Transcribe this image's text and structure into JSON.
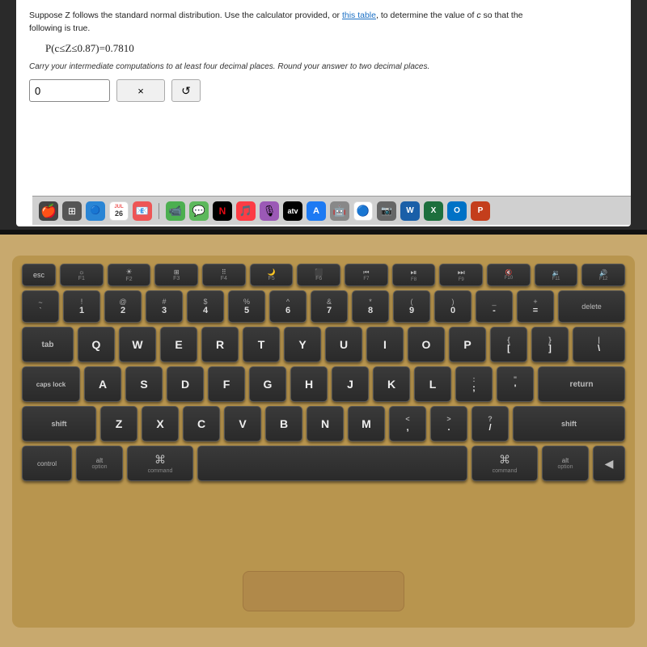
{
  "screen": {
    "problem_line1": "Suppose Z follows the standard normal distribution. Use the calculator provided, or ",
    "problem_link": "this table",
    "problem_line2": ", to determine the value of ",
    "problem_italic": "c",
    "problem_line3": " so that the",
    "problem_line4": "following is true.",
    "formula": "P(c≤Z≤0.87)=0.7810",
    "carry_text": "Carry your intermediate computations to at least four decimal places. Round your answer to two decimal places.",
    "input_placeholder": "0",
    "btn_x_label": "×",
    "btn_reset_label": "↺"
  },
  "dock": {
    "icons": [
      "🍎",
      "⊞",
      "📅",
      "🟢",
      "✉",
      "💬",
      "🎵",
      "🎙",
      "📺",
      "A",
      "🔵",
      "🟡",
      "W",
      "X",
      "O"
    ]
  },
  "keyboard": {
    "rows": {
      "fn": [
        "esc",
        "F1",
        "F2",
        "F3",
        "F4",
        "F5",
        "F6",
        "F7",
        "F8",
        "F9",
        "F10",
        "F11",
        "F12"
      ],
      "numbers": [
        "~`",
        "!1",
        "@2",
        "#3",
        "$4",
        "%5",
        "^6",
        "&7",
        "*8",
        "(9",
        ")0",
        "-",
        "=",
        "⌫"
      ],
      "qwerty": [
        "tab",
        "Q",
        "W",
        "E",
        "R",
        "T",
        "Y",
        "U",
        "I",
        "O",
        "P",
        "{[",
        "}]"
      ],
      "asdf": [
        "caps",
        "A",
        "S",
        "D",
        "F",
        "G",
        "H",
        "J",
        "K",
        "L",
        ";:",
        "'\"",
        "return"
      ],
      "zxcv": [
        "shift",
        "Z",
        "X",
        "C",
        "V",
        "B",
        "N",
        "M",
        "<,",
        ">.",
        "?/",
        "shift"
      ],
      "bottom": [
        "control",
        "option",
        "command",
        " ",
        "⌘",
        "alt",
        "option",
        "◀"
      ]
    },
    "bottom_labels": {
      "control": "control",
      "option_l": "option",
      "command_l": "command",
      "command_r": "command",
      "option_r": "option",
      "arrow": "◀"
    }
  }
}
